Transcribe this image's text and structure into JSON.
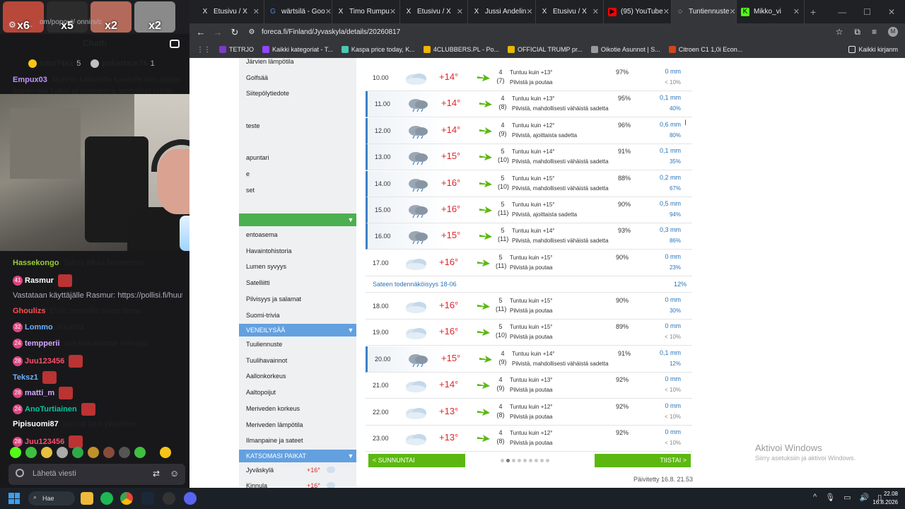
{
  "chat": {
    "url_fragment": "om/popout/   onnirs/c",
    "title": "Chatti",
    "top_gifters": [
      {
        "name": "toho74xx",
        "count": "5"
      },
      {
        "name": "pokerface76",
        "count": "1"
      }
    ],
    "top_emote_counts": [
      "x6",
      "x5",
      "x2",
      "x2"
    ],
    "messages_top": [
      {
        "user": "Empux03",
        "color": "#bf94ff",
        "text": ": Monnin kaltaselle kaverille kun antais"
      },
      {
        "user": "",
        "color": "#efeff1",
        "text": "aseen niin kaikki ei suomessa syntyneet kuolis"
      }
    ],
    "messages": [
      {
        "user": "Hassekongo",
        "color": "#9acd32",
        "text": ": Syksy alkaa huomenna",
        "badge": ""
      },
      {
        "user": "Rasmur",
        "color": "#ffffff",
        "text": ":",
        "badge": "41"
      },
      {
        "user": "",
        "color": "#adadb8",
        "text": "Vastataan käyttäjälle Rasmur: https://pollisi.fi/huuto...",
        "badge": ""
      },
      {
        "user": "Ghoulizs",
        "color": "#ff4f4f",
        "text": ": Ei oo monnilla asiaa tänne",
        "badge": ""
      },
      {
        "user": "Lommo",
        "color": "#6ab0ff",
        "text": ": huutista",
        "badge": "32"
      },
      {
        "user": "tempperii",
        "color": "#d2a8ff",
        "text": ": uus kallukooste esiintyjä",
        "badge": "24"
      },
      {
        "user": "Juu123456",
        "color": "#ff4f6a",
        "text": ":",
        "badge": "28"
      },
      {
        "user": "Teksz1",
        "color": "#6ab0ff",
        "text": ":",
        "badge": ""
      },
      {
        "user": "matti_m",
        "color": "#d2a8ff",
        "text": ":",
        "badge": "28"
      },
      {
        "user": "AnoTurtiainen",
        "color": "#00c8a0",
        "text": ":",
        "badge": "24"
      },
      {
        "user": "Pipisuomi87",
        "color": "#ffffff",
        "text": ": joo mä kävi yliopiston",
        "badge": ""
      },
      {
        "user": "Juu123456",
        "color": "#ff4f6a",
        "text": ":",
        "badge": "28"
      }
    ],
    "input_placeholder": "Lähetä viesti"
  },
  "browser": {
    "tabs": [
      {
        "label": "Etusivu / X",
        "icon": "x-icon",
        "color": "#000000"
      },
      {
        "label": "wärtsilä - Goo",
        "icon": "google-icon",
        "color": "#ffffff"
      },
      {
        "label": "Timo Rumpu",
        "icon": "x-icon",
        "color": "#000000"
      },
      {
        "label": "Etusivu / X",
        "icon": "x-icon",
        "color": "#000000"
      },
      {
        "label": "Jussi Andelin",
        "icon": "x-icon",
        "color": "#000000"
      },
      {
        "label": "Etusivu / X",
        "icon": "x-icon",
        "color": "#000000"
      },
      {
        "label": "(95) YouTube",
        "icon": "youtube-icon",
        "color": "#ff0000"
      },
      {
        "label": "Tuntiennuste",
        "icon": "loading-icon",
        "color": "#4a90d9",
        "active": true
      },
      {
        "label": "Mikko_vi",
        "icon": "kick-icon",
        "color": "#53fc18"
      }
    ],
    "url": "foreca.fi/Finland/Jyvaskyla/details/20260817",
    "bookmarks": [
      {
        "label": "TETRJO",
        "color": "#7a3cc6"
      },
      {
        "label": "Kaikki kategoriat - T...",
        "color": "#9146ff"
      },
      {
        "label": "Kaspa price today, K...",
        "color": "#49c8b4"
      },
      {
        "label": "4CLUBBERS.PL - Po...",
        "color": "#f4b400"
      },
      {
        "label": "OFFICIAL TRUMP pr...",
        "color": "#e6b800"
      },
      {
        "label": "Oikotie Asunnot | S...",
        "color": "#999999"
      },
      {
        "label": "Citroen C1 1,0i Econ...",
        "color": "#d4441c"
      }
    ],
    "bookmarks_right": "Kaikki kirjanm"
  },
  "leftnav": {
    "items_top": [
      "Järvien lämpötila",
      "Golfsää",
      "Siitepölytiedote",
      "",
      "teste",
      "",
      "apuntari",
      "e",
      "set"
    ],
    "section_green": "",
    "items_mid": [
      "entoasema",
      "Havaintohistoria",
      "Lumen syvyys",
      "Satelliitti",
      "Pilvisyys ja salamat",
      "Suomi-trivia"
    ],
    "section_boating": "VENEILYSÄÄ",
    "items_boating": [
      "Tuuliennuste",
      "Tuulihavainnot",
      "Aallonkorkeus",
      "Aaltopoijut",
      "Meriveden korkeus",
      "Meriveden lämpötila",
      "Ilmanpaine ja sateet"
    ],
    "section_places": "KATSOMASI PAIKAT",
    "places": [
      {
        "name": "Jyväskylä",
        "temp": "+16°"
      },
      {
        "name": "Kinnula",
        "temp": "+16°"
      }
    ]
  },
  "forecast": {
    "rows_a": [
      {
        "time": "10.00",
        "temp": "+14°",
        "wind": "4",
        "gust": "(7)",
        "desc1": "Tuntuu kuin +13°",
        "desc2": "Pilvistä ja poutaa",
        "hum": "97%",
        "mm": "0 mm",
        "prob": "< 10%",
        "rain": false
      },
      {
        "time": "11.00",
        "temp": "+14°",
        "wind": "4",
        "gust": "(8)",
        "desc1": "Tuntuu kuin +13°",
        "desc2": "Pilvistä, mahdollisesti vähäistä sadetta",
        "hum": "95%",
        "mm": "0,1 mm",
        "prob": "40%",
        "rain": true
      },
      {
        "time": "12.00",
        "temp": "+14°",
        "wind": "4",
        "gust": "(9)",
        "desc1": "Tuntuu kuin +12°",
        "desc2": "Pilvistä, ajoittaista sadetta",
        "hum": "96%",
        "mm": "0,6 mm",
        "prob": "80%",
        "rain": true
      },
      {
        "time": "13.00",
        "temp": "+15°",
        "wind": "5",
        "gust": "(10)",
        "desc1": "Tuntuu kuin +14°",
        "desc2": "Pilvistä, mahdollisesti vähäistä sadetta",
        "hum": "91%",
        "mm": "0,1 mm",
        "prob": "35%",
        "rain": true
      },
      {
        "time": "14.00",
        "temp": "+16°",
        "wind": "5",
        "gust": "(10)",
        "desc1": "Tuntuu kuin +15°",
        "desc2": "Pilvistä, mahdollisesti vähäistä sadetta",
        "hum": "88%",
        "mm": "0,2 mm",
        "prob": "67%",
        "rain": true
      },
      {
        "time": "15.00",
        "temp": "+16°",
        "wind": "5",
        "gust": "(11)",
        "desc1": "Tuntuu kuin +15°",
        "desc2": "Pilvistä, ajoittaista sadetta",
        "hum": "90%",
        "mm": "0,5 mm",
        "prob": "94%",
        "rain": true
      },
      {
        "time": "16.00",
        "temp": "+15°",
        "wind": "5",
        "gust": "(11)",
        "desc1": "Tuntuu kuin +14°",
        "desc2": "Pilvistä, mahdollisesti vähäistä sadetta",
        "hum": "93%",
        "mm": "0,3 mm",
        "prob": "86%",
        "rain": true
      },
      {
        "time": "17.00",
        "temp": "+16°",
        "wind": "5",
        "gust": "(11)",
        "desc1": "Tuntuu kuin +15°",
        "desc2": "Pilvistä ja poutaa",
        "hum": "90%",
        "mm": "0 mm",
        "prob": "23%",
        "rain": false
      }
    ],
    "rain_prob_label": "Sateen todennäköisyys 18-06",
    "rain_prob_value": "12%",
    "rows_b": [
      {
        "time": "18.00",
        "temp": "+16°",
        "wind": "5",
        "gust": "(11)",
        "desc1": "Tuntuu kuin +15°",
        "desc2": "Pilvistä ja poutaa",
        "hum": "90%",
        "mm": "0 mm",
        "prob": "30%",
        "rain": false
      },
      {
        "time": "19.00",
        "temp": "+16°",
        "wind": "5",
        "gust": "(10)",
        "desc1": "Tuntuu kuin +15°",
        "desc2": "Pilvistä ja poutaa",
        "hum": "89%",
        "mm": "0 mm",
        "prob": "< 10%",
        "rain": false
      },
      {
        "time": "20.00",
        "temp": "+15°",
        "wind": "4",
        "gust": "(9)",
        "desc1": "Tuntuu kuin +14°",
        "desc2": "Pilvistä, mahdollisesti vähäistä sadetta",
        "hum": "91%",
        "mm": "0,1 mm",
        "prob": "12%",
        "rain": true
      },
      {
        "time": "21.00",
        "temp": "+14°",
        "wind": "4",
        "gust": "(9)",
        "desc1": "Tuntuu kuin +13°",
        "desc2": "Pilvistä ja poutaa",
        "hum": "92%",
        "mm": "0 mm",
        "prob": "< 10%",
        "rain": false
      },
      {
        "time": "22.00",
        "temp": "+13°",
        "wind": "4",
        "gust": "(8)",
        "desc1": "Tuntuu kuin +12°",
        "desc2": "Pilvistä ja poutaa",
        "hum": "92%",
        "mm": "0 mm",
        "prob": "< 10%",
        "rain": false
      },
      {
        "time": "23.00",
        "temp": "+13°",
        "wind": "4",
        "gust": "(8)",
        "desc1": "Tuntuu kuin +12°",
        "desc2": "Pilvistä ja poutaa",
        "hum": "92%",
        "mm": "0 mm",
        "prob": "< 10%",
        "rain": false
      }
    ],
    "prev_label": "< SUNNUNTAI",
    "next_label": "TIISTAI >",
    "updated": "Päivitetty 16.8. 21.53",
    "page_dots": 9,
    "active_dot": 1
  },
  "windows_activation": {
    "title": "Aktivoi Windows",
    "subtitle": "Siirry asetuksiin ja aktivoi Windows."
  },
  "taskbar": {
    "search_label": "Hae",
    "time": "22.08",
    "date": "16.8.2026"
  },
  "colors": {
    "temp": "#e2252b",
    "rain_blue": "#2a73b8",
    "wind_green": "#5cb811",
    "button_green": "#5cb811",
    "nav_blue": "#63a0e0"
  }
}
